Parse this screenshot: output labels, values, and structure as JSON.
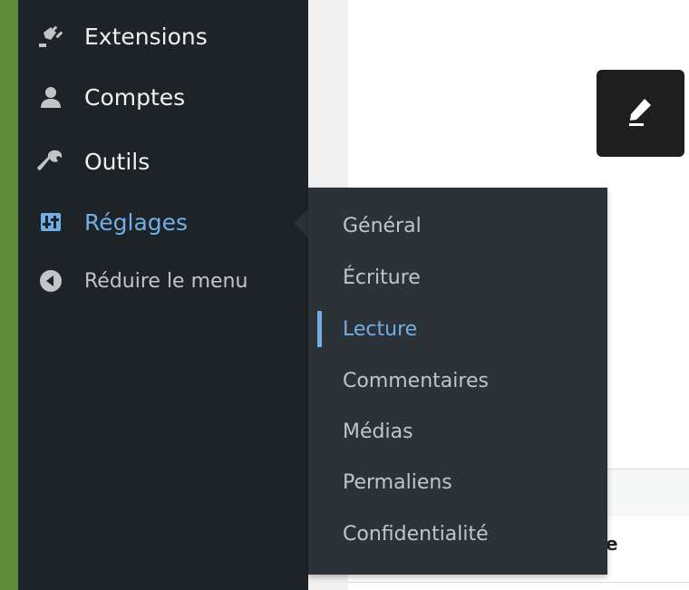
{
  "sidebar": {
    "items": [
      {
        "label": "Extensions",
        "icon": "plugin-icon"
      },
      {
        "label": "Comptes",
        "icon": "users-icon"
      },
      {
        "label": "Outils",
        "icon": "wrench-icon"
      },
      {
        "label": "Réglages",
        "icon": "settings-icon",
        "active": true
      },
      {
        "label": "Réduire le menu",
        "icon": "collapse-icon"
      }
    ]
  },
  "submenu": {
    "items": [
      {
        "label": "Général"
      },
      {
        "label": "Écriture"
      },
      {
        "label": "Lecture",
        "current": true
      },
      {
        "label": "Commentaires"
      },
      {
        "label": "Médias"
      },
      {
        "label": "Permaliens"
      },
      {
        "label": "Confidentialité"
      }
    ]
  },
  "content": {
    "column_fragment": "e"
  },
  "colors": {
    "sidebar_bg": "#1d2327",
    "submenu_bg": "#2c3338",
    "accent": "#72aee6",
    "edge_green": "#5f8c3a"
  }
}
